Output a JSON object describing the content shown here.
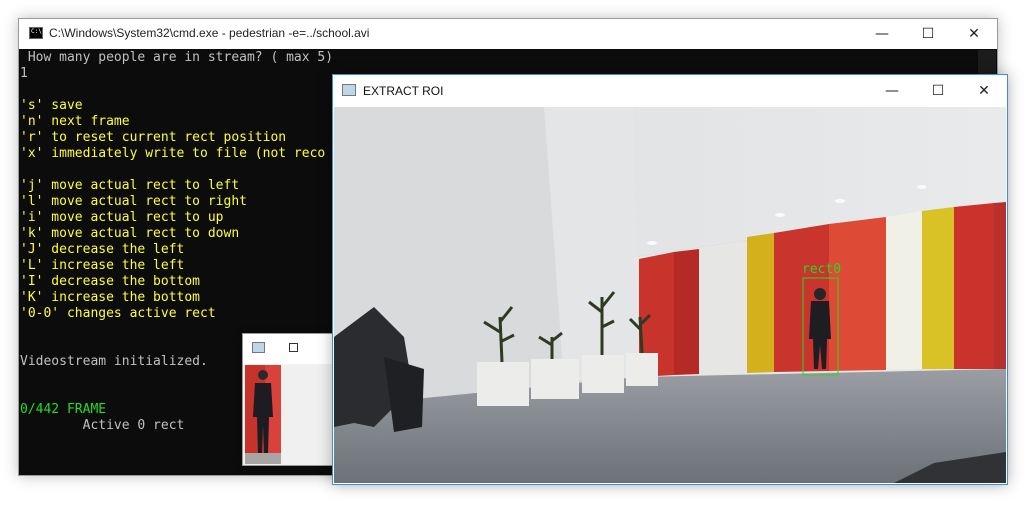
{
  "cmd_window": {
    "title": "C:\\Windows\\System32\\cmd.exe - pedestrian  -e=../school.avi",
    "minimize_glyph": "—",
    "maximize_glyph": "☐",
    "close_glyph": "✕",
    "lines": [
      {
        "text": " How many people are in stream? ( max 5)",
        "color": "gray"
      },
      {
        "text": "1",
        "color": "gray"
      },
      {
        "text": "",
        "color": "gray"
      },
      {
        "text": "'s' save",
        "color": "yellow"
      },
      {
        "text": "'n' next frame",
        "color": "yellow"
      },
      {
        "text": "'r' to reset current rect position",
        "color": "yellow"
      },
      {
        "text": "'x' immediately write to file (not reco",
        "color": "yellow"
      },
      {
        "text": "",
        "color": "yellow"
      },
      {
        "text": "'j' move actual rect to left",
        "color": "yellow"
      },
      {
        "text": "'l' move actual rect to right",
        "color": "yellow"
      },
      {
        "text": "'i' move actual rect to up",
        "color": "yellow"
      },
      {
        "text": "'k' move actual rect to down",
        "color": "yellow"
      },
      {
        "text": "'J' decrease the left",
        "color": "yellow"
      },
      {
        "text": "'L' increase the left",
        "color": "yellow"
      },
      {
        "text": "'I' decrease the bottom",
        "color": "yellow"
      },
      {
        "text": "'K' increase the bottom",
        "color": "yellow"
      },
      {
        "text": "'0-0' changes active rect",
        "color": "yellow"
      },
      {
        "text": "",
        "color": "gray"
      },
      {
        "text": "",
        "color": "gray"
      },
      {
        "text": "Videostream initialized.",
        "color": "gray"
      },
      {
        "text": "",
        "color": "gray"
      },
      {
        "text": "",
        "color": "gray"
      },
      {
        "text": "0/442 FRAME",
        "color": "green"
      },
      {
        "text": "        Active 0 rect",
        "color": "gray"
      }
    ]
  },
  "roi_window": {
    "title": "EXTRACT ROI",
    "minimize_glyph": "—",
    "maximize_glyph": "☐",
    "close_glyph": "✕",
    "rect_label": "rect0",
    "rect_color": "#22dd22"
  },
  "colors": {
    "console_bg": "#0c0c0c",
    "console_text": "#c0c0c0",
    "console_yellow": "#ffff33",
    "console_green": "#22dd22",
    "accent_border": "#3c8ee0"
  }
}
